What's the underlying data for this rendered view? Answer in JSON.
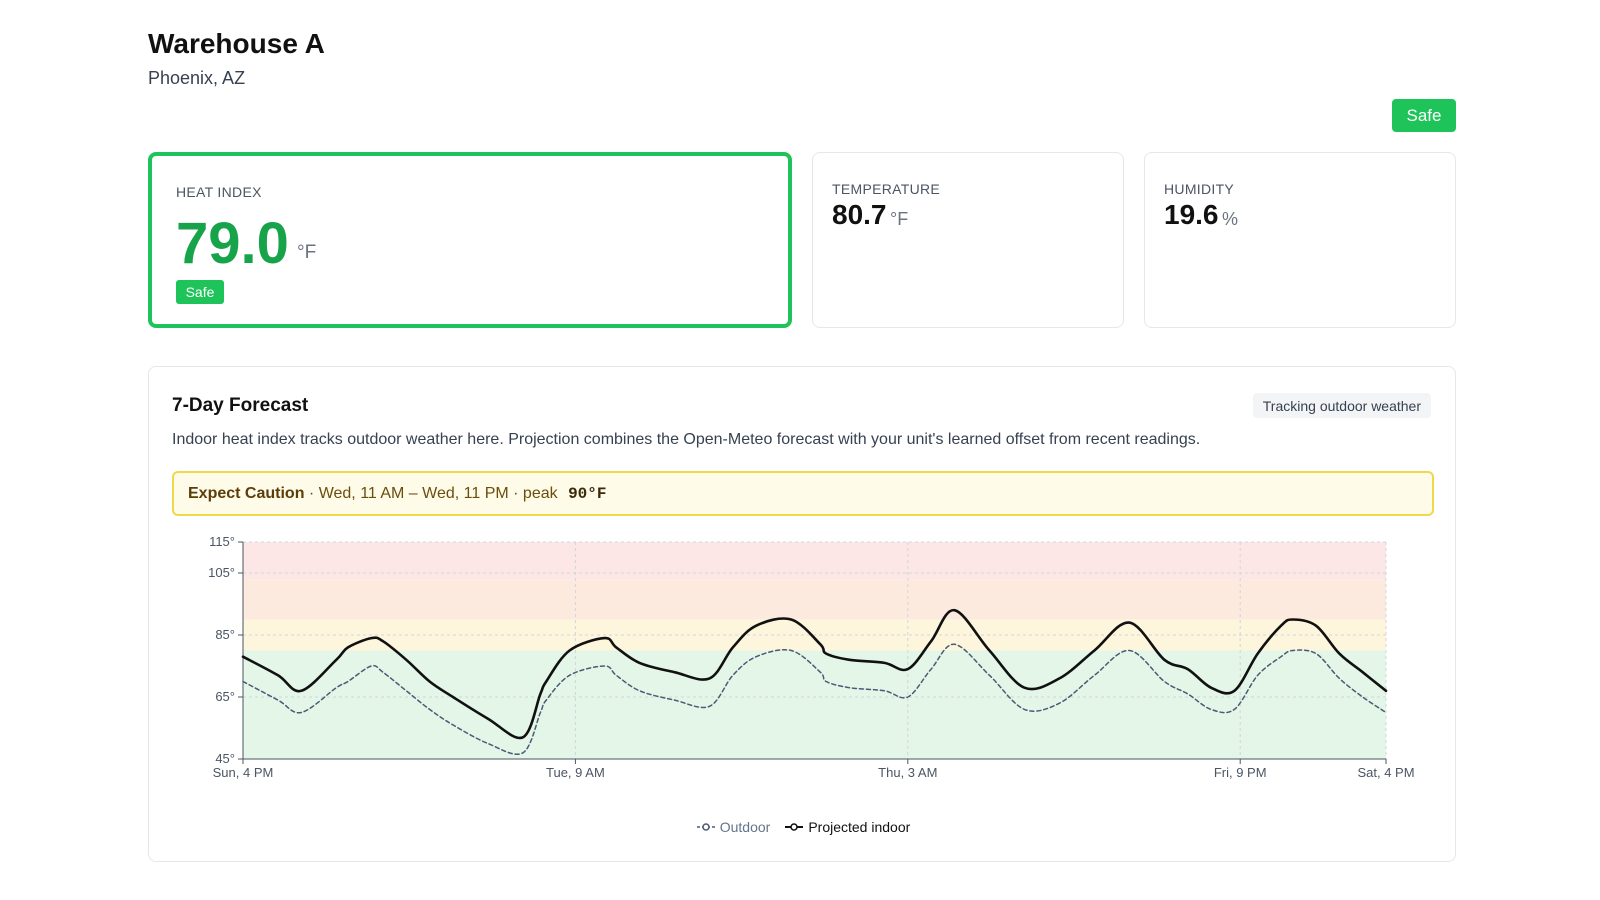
{
  "header": {
    "site_name": "Warehouse A",
    "location": "Phoenix, AZ",
    "status_button": "Safe"
  },
  "metrics": {
    "heat_index": {
      "label": "HEAT INDEX",
      "value": "79.0",
      "unit": "°F",
      "badge": "Safe",
      "accent": "#1ec45a"
    },
    "temperature": {
      "label": "TEMPERATURE",
      "value": "80.7",
      "unit": "°F"
    },
    "humidity": {
      "label": "HUMIDITY",
      "value": "19.6",
      "unit": "%"
    }
  },
  "forecast": {
    "title": "7-Day Forecast",
    "mode_pill": "Tracking outdoor weather",
    "description": "Indoor heat index tracks outdoor weather here. Projection combines the Open-Meteo forecast with your unit's learned offset from recent readings.",
    "alert": {
      "level": "Expect Caution",
      "window": " · Wed, 11 AM – Wed, 11 PM · peak ",
      "peak": "90°F"
    }
  },
  "chart_data": {
    "type": "line",
    "x_ticks": [
      "Sun, 4 PM",
      "Tue, 9 AM",
      "Thu, 3 AM",
      "Fri, 9 PM",
      "Sat, 4 PM"
    ],
    "y_ticks": [
      "45°",
      "65°",
      "85°",
      "105°",
      "115°"
    ],
    "ylim": [
      45,
      115
    ],
    "x_hours": [
      0,
      6,
      10,
      16,
      18,
      22,
      24,
      28,
      32,
      36,
      42,
      48,
      51,
      52,
      56,
      62,
      64,
      68,
      74,
      80,
      84,
      88,
      94,
      99,
      100,
      104,
      110,
      114,
      118,
      122,
      128,
      134,
      140,
      146,
      152,
      158,
      162,
      166,
      170,
      174,
      178,
      180,
      184,
      188,
      192,
      196
    ],
    "series": [
      {
        "name": "Outdoor",
        "color": "#4b5a75",
        "style": "dashed",
        "values": [
          70,
          64,
          60,
          68,
          70,
          75,
          73,
          67,
          61,
          56,
          50,
          47,
          60,
          64,
          72,
          75,
          72,
          67,
          64,
          62,
          72,
          78,
          80,
          73,
          70,
          68,
          67,
          65,
          74,
          82,
          72,
          61,
          63,
          72,
          80,
          70,
          66,
          61,
          61,
          72,
          78,
          80,
          79,
          71,
          65,
          60
        ]
      },
      {
        "name": "Projected indoor",
        "color": "#111111",
        "style": "solid",
        "values": [
          78,
          72,
          67,
          77,
          81,
          84,
          83,
          77,
          70,
          65,
          58,
          52,
          66,
          70,
          80,
          84,
          81,
          76,
          73,
          71,
          81,
          88,
          90,
          82,
          79,
          77,
          76,
          74,
          83,
          93,
          80,
          68,
          71,
          80,
          89,
          77,
          74,
          68,
          67,
          79,
          88,
          90,
          88,
          79,
          73,
          67
        ]
      }
    ],
    "bands": [
      {
        "from": 45,
        "to": 80,
        "color": "#e4f6e8"
      },
      {
        "from": 80,
        "to": 90,
        "color": "#fdf5dc"
      },
      {
        "from": 90,
        "to": 103,
        "color": "#fdeade"
      },
      {
        "from": 103,
        "to": 115,
        "color": "#fce6e6"
      }
    ],
    "grid": true,
    "legend_position": "bottom-center"
  }
}
